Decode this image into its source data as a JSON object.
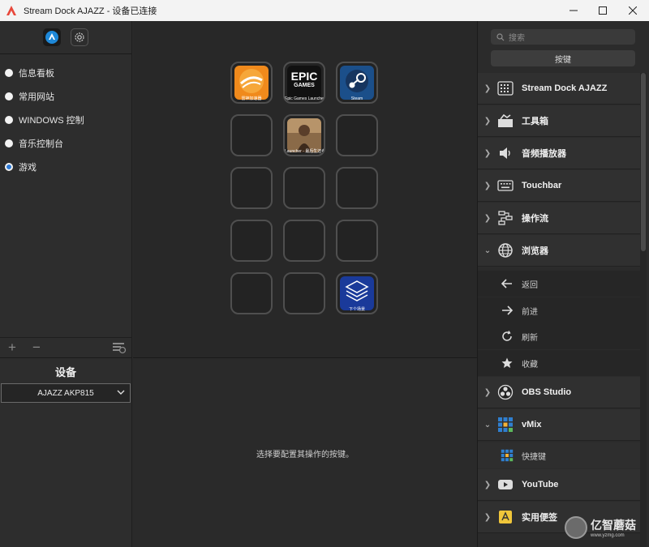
{
  "window": {
    "title": "Stream Dock AJAZZ - 设备已连接",
    "controls": [
      "minimize",
      "maximize",
      "close"
    ]
  },
  "left": {
    "scenes": [
      {
        "label": "信息看板",
        "selected": false
      },
      {
        "label": "常用网站",
        "selected": false
      },
      {
        "label": "WINDOWS 控制",
        "selected": false
      },
      {
        "label": "音乐控制台",
        "selected": false
      },
      {
        "label": "游戏",
        "selected": true
      }
    ],
    "device": {
      "title": "设备",
      "selected": "AJAZZ AKP815"
    }
  },
  "keys": [
    {
      "label": "雷神加速器",
      "icon": "leigod-icon",
      "color": "#f08a1c"
    },
    {
      "label": "Epic Games Launcher",
      "icon": "epic-games-icon",
      "color": "#111111",
      "logo_text": "EPIC",
      "logo_sub": "GAMES"
    },
    {
      "label": "Steam",
      "icon": "steam-icon",
      "color": "#1b4f8a"
    },
    {
      "label": "",
      "icon": "",
      "color": ""
    },
    {
      "label": "Launcher - 最后生还者",
      "icon": "game-cover-icon",
      "color": "#7a5a3a"
    },
    {
      "label": "",
      "icon": "",
      "color": ""
    },
    {
      "label": "下个场景",
      "icon": "layers-icon",
      "color": "#1a3a9a"
    }
  ],
  "center": {
    "hint": "选择要配置其操作的按键。"
  },
  "right": {
    "search_placeholder": "搜索",
    "tab_label": "按键",
    "categories": [
      {
        "label": "Stream Dock AJAZZ",
        "icon": "keypad-icon",
        "expanded": false
      },
      {
        "label": "工具箱",
        "icon": "toolbox-icon",
        "expanded": false
      },
      {
        "label": "音频播放器",
        "icon": "speaker-icon",
        "expanded": false
      },
      {
        "label": "Touchbar",
        "icon": "keyboard-icon",
        "expanded": false
      },
      {
        "label": "操作流",
        "icon": "flow-icon",
        "expanded": false
      },
      {
        "label": "浏览器",
        "icon": "globe-icon",
        "expanded": true
      },
      {
        "label": "OBS Studio",
        "icon": "obs-icon",
        "expanded": false
      },
      {
        "label": "vMix",
        "icon": "vmix-icon",
        "expanded": true
      },
      {
        "label": "YouTube",
        "icon": "youtube-icon",
        "expanded": false
      },
      {
        "label": "实用便签",
        "icon": "sticky-note-icon",
        "expanded": false
      }
    ],
    "browser_actions": [
      {
        "label": "返回",
        "icon": "arrow-left-icon"
      },
      {
        "label": "前进",
        "icon": "arrow-right-icon"
      },
      {
        "label": "刷新",
        "icon": "refresh-icon"
      },
      {
        "label": "收藏",
        "icon": "star-icon"
      }
    ],
    "vmix_actions": [
      {
        "label": "快捷键",
        "icon": "vmix-grid-icon"
      }
    ]
  },
  "watermark": {
    "title": "亿智蘑菇",
    "url": "www.yzmg.com"
  }
}
